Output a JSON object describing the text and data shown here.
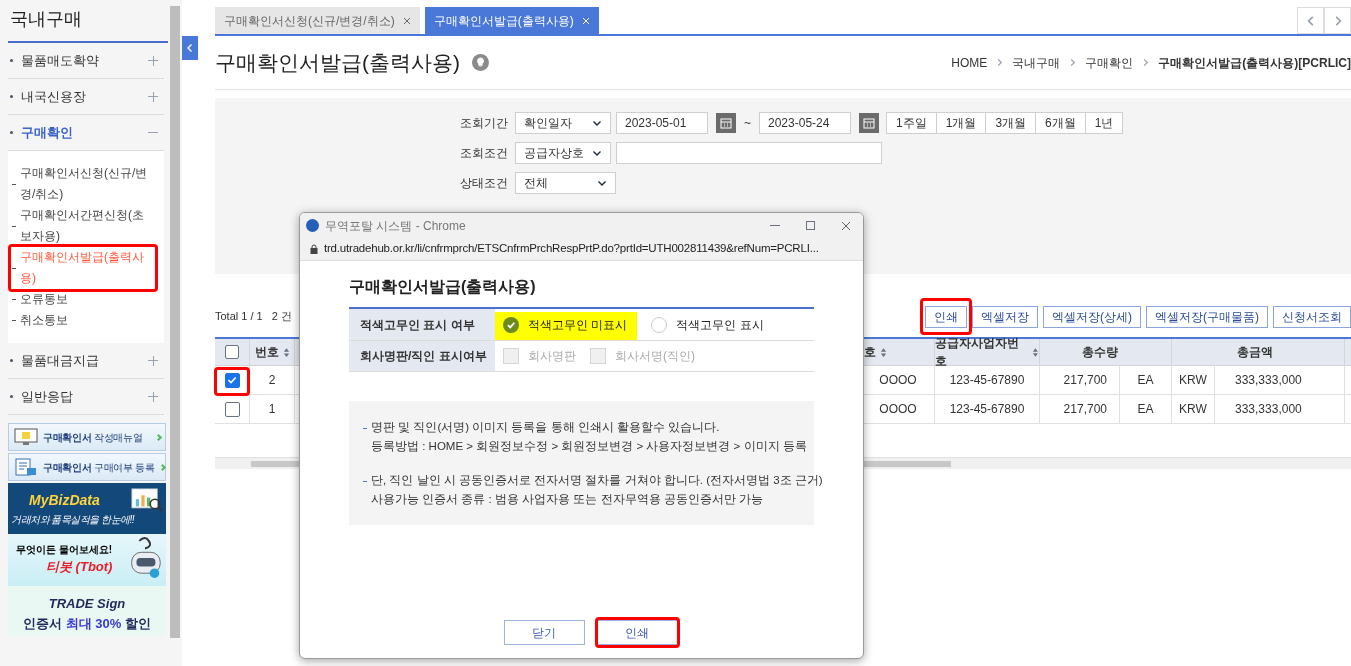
{
  "sidebar": {
    "title": "국내구매",
    "menu": [
      {
        "label": "물품매도확약",
        "expanded": false
      },
      {
        "label": "내국신용장",
        "expanded": false
      },
      {
        "label": "구매확인",
        "expanded": true,
        "children": [
          {
            "label": "구매확인서신청(신규/변경/취소)",
            "selected": false,
            "highlighted": false
          },
          {
            "label": "구매확인서간편신청(초보자용)",
            "selected": false,
            "highlighted": false
          },
          {
            "label": "구매확인서발급(출력사용)",
            "selected": true,
            "highlighted": true
          },
          {
            "label": "오류통보",
            "selected": false,
            "highlighted": false
          },
          {
            "label": "취소통보",
            "selected": false,
            "highlighted": false
          }
        ]
      },
      {
        "label": "물품대금지급",
        "expanded": false
      },
      {
        "label": "일반응답",
        "expanded": false
      }
    ],
    "banners": [
      {
        "kind": "manual",
        "text": "**구매확인서** 작성매뉴얼"
      },
      {
        "kind": "register",
        "text": "**구매확인서** 구매여부 등록"
      },
      {
        "kind": "mybiz",
        "title": "MyBizData",
        "text": "거래처와 품목실적을 한눈에!!"
      },
      {
        "kind": "tbot",
        "title": "무엇이든 물어보세요!",
        "text": "티봇 (Tbot)"
      },
      {
        "kind": "tradesign",
        "title": "TRADE Sign",
        "text": "인증서 **최대 30%** 할인"
      }
    ]
  },
  "tabs": [
    {
      "label": "구매확인서신청(신규/변경/취소)",
      "selected": false
    },
    {
      "label": "구매확인서발급(출력사용)",
      "selected": true
    }
  ],
  "page": {
    "title": "구매확인서발급(출력사용)",
    "breadcrumb": [
      "HOME",
      "국내구매",
      "구매확인",
      "구매확인서발급(출력사용)[PCRLIC]"
    ]
  },
  "search": [
    {
      "kind": "period",
      "label": "조회기간",
      "select": "확인일자",
      "from": "2023-05-01",
      "separator": "~",
      "to": "2023-05-24",
      "quick": [
        "1주일",
        "1개월",
        "3개월",
        "6개월",
        "1년"
      ]
    },
    {
      "kind": "text",
      "label": "조회조건",
      "select": "공급자상호"
    },
    {
      "kind": "select",
      "label": "상태조건",
      "select": "전체"
    }
  ],
  "total": "Total 1 / 1   2 건",
  "toolbar": [
    {
      "label": "인쇄",
      "highlighted": true
    },
    {
      "label": "엑셀저장",
      "highlighted": false
    },
    {
      "label": "엑셀저장(상세)",
      "highlighted": false
    },
    {
      "label": "엑셀저장(구매물품)",
      "highlighted": false
    },
    {
      "label": "신청서조회",
      "highlighted": false
    }
  ],
  "table": {
    "select_all": false,
    "columns": [
      {
        "label": "번호",
        "sortable": true
      },
      {},
      {
        "label": "호",
        "sortable": true
      },
      {
        "label": "공급자사업자번호",
        "sortable": true
      },
      {
        "label": "총수량",
        "sortable": false
      },
      {
        "sortable": false
      },
      {
        "sortable": false
      },
      {
        "label": "총금액",
        "sortable": false
      }
    ],
    "rows": [
      {
        "checked": true,
        "highlighted": true,
        "cells": [
          "2",
          "",
          "OOOO",
          "123-45-67890",
          "217,700",
          "EA",
          "KRW",
          "333,333,000"
        ]
      },
      {
        "checked": false,
        "highlighted": false,
        "cells": [
          "1",
          "",
          "OOOO",
          "123-45-67890",
          "217,700",
          "EA",
          "KRW",
          "333,333,000"
        ]
      }
    ]
  },
  "popup": {
    "window_title": "무역포탈 시스템 - Chrome",
    "url": "trd.utradehub.or.kr/li/cnfrmprch/ETSCnfrmPrchRespPrtP.do?prtId=UTH002811439&refNum=PCRLI...",
    "heading": "구매확인서발급(출력사용)",
    "options": [
      {
        "kind": "radio",
        "label": "적색고무인 표시 여부",
        "disabled": false,
        "choices": [
          {
            "label": "적색고무인 미표시",
            "selected": true,
            "highlighted": true
          },
          {
            "label": "적색고무인 표시",
            "selected": false,
            "highlighted": false
          }
        ]
      },
      {
        "kind": "checkbox",
        "label": "회사명판/직인 표시여부",
        "disabled": true,
        "choices": [
          {
            "label": "회사명판",
            "checked": false
          },
          {
            "label": "회사서명(직인)",
            "checked": false
          }
        ]
      }
    ],
    "notes": [
      [
        "명판 및 직인(서명) 이미지 등록을 통해 인쇄시 활용할수 있습니다.",
        "등록방법 : HOME > 회원정보수정 > 회원정보변경 > 사용자정보변경 > 이미지 등록"
      ],
      [
        "단, 직인 날인 시 공동인증서로 전자서명 절차를 거쳐야 합니다. (전자서명법 3조 근거)",
        "사용가능 인증서 종류 : 범용 사업자용 또는 전자무역용 공동인증서만 가능"
      ]
    ],
    "buttons": [
      {
        "label": "닫기",
        "highlighted": false
      },
      {
        "label": "인쇄",
        "highlighted": true
      }
    ]
  }
}
